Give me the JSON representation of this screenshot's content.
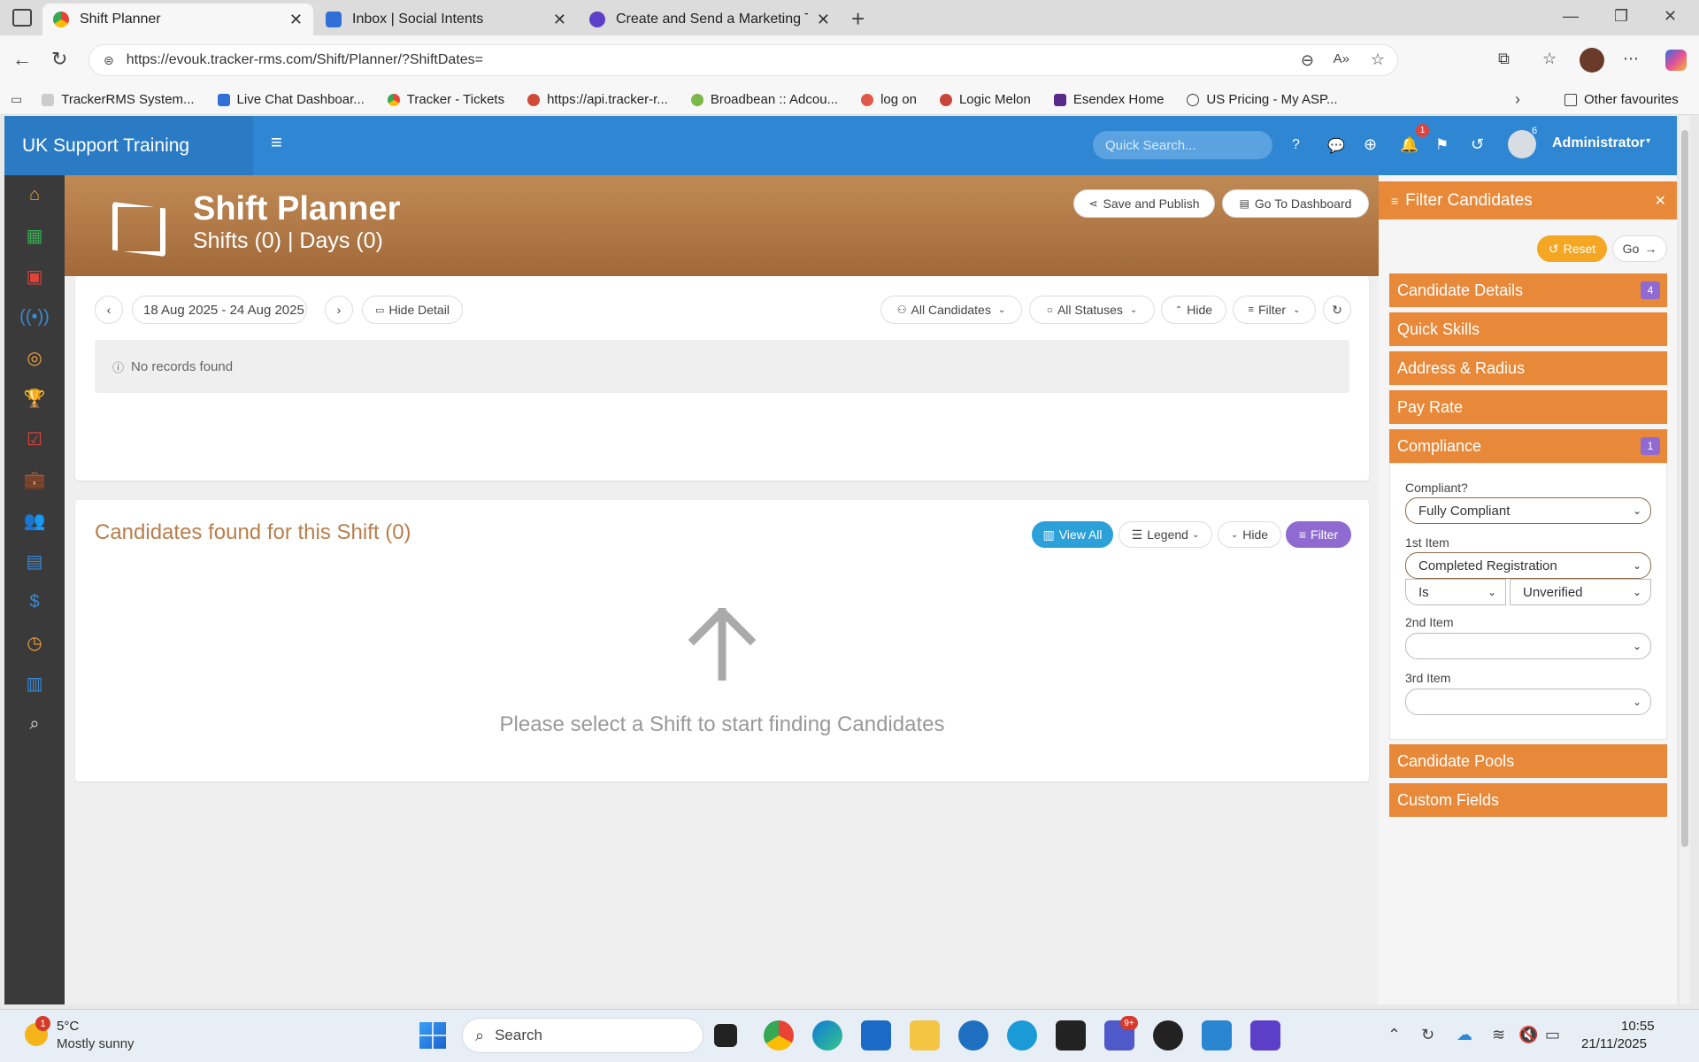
{
  "browser": {
    "tabs": [
      {
        "title": "Shift Planner",
        "active": true
      },
      {
        "title": "Inbox | Social Intents",
        "active": false
      },
      {
        "title": "Create and Send a Marketing Tem",
        "active": false
      }
    ],
    "url": "https://evouk.tracker-rms.com/Shift/Planner/?ShiftDates=",
    "bookmarks": [
      "TrackerRMS System...",
      "Live Chat Dashboar...",
      "Tracker - Tickets",
      "https://api.tracker-r...",
      "Broadbean :: Adcou...",
      "log on",
      "Logic Melon",
      "Esendex Home",
      "US Pricing - My ASP..."
    ],
    "other_favourites": "Other favourites"
  },
  "app": {
    "brand": "UK Support Training",
    "search_placeholder": "Quick Search...",
    "notification_count": "1",
    "avatar_count": "6",
    "user": "Administrator"
  },
  "header": {
    "title": "Shift Planner",
    "subtitle": "Shifts (0) | Days (0)",
    "save_publish": "Save and Publish",
    "go_dashboard": "Go To Dashboard"
  },
  "shifts": {
    "date_range": "18 Aug 2025 - 24 Aug 2025",
    "hide_detail": "Hide Detail",
    "all_candidates": "All Candidates",
    "all_statuses": "All Statuses",
    "hide": "Hide",
    "filter": "Filter",
    "no_records": "No records found"
  },
  "candidates": {
    "title": "Candidates found for this Shift (0)",
    "view_all": "View All",
    "legend": "Legend",
    "hide": "Hide",
    "filter": "Filter",
    "empty_message": "Please select a Shift to start finding Candidates"
  },
  "filter_panel": {
    "title": "Filter Candidates",
    "reset": "Reset",
    "go": "Go",
    "sections": [
      {
        "label": "Candidate Details",
        "badge": "4"
      },
      {
        "label": "Quick Skills",
        "badge": ""
      },
      {
        "label": "Address & Radius",
        "badge": ""
      },
      {
        "label": "Pay Rate",
        "badge": ""
      },
      {
        "label": "Compliance",
        "badge": "1"
      },
      {
        "label": "Candidate Pools",
        "badge": ""
      },
      {
        "label": "Custom Fields",
        "badge": ""
      }
    ],
    "compliance": {
      "compliant_label": "Compliant?",
      "compliant_value": "Fully Compliant",
      "item1_label": "1st Item",
      "item1_value": "Completed Registration",
      "item1_operator": "Is",
      "item1_status": "Unverified",
      "item2_label": "2nd Item",
      "item2_value": "",
      "item3_label": "3rd Item",
      "item3_value": ""
    }
  },
  "taskbar": {
    "weather_temp": "5°C",
    "weather_desc": "Mostly sunny",
    "weather_badge": "1",
    "search": "Search",
    "teams_badge": "9+",
    "time": "10:55",
    "date": "21/11/2025"
  }
}
